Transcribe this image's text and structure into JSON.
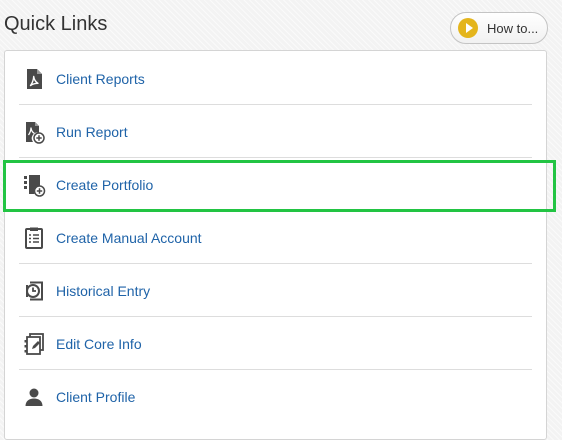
{
  "header": {
    "title": "Quick Links",
    "howto_label": "How to..."
  },
  "quick_links": [
    {
      "label": "Client Reports",
      "icon": "pdf-document-icon"
    },
    {
      "label": "Run Report",
      "icon": "run-report-icon"
    },
    {
      "label": "Create Portfolio",
      "icon": "create-portfolio-icon"
    },
    {
      "label": "Create Manual Account",
      "icon": "manual-account-icon"
    },
    {
      "label": "Historical Entry",
      "icon": "history-clock-icon"
    },
    {
      "label": "Edit Core Info",
      "icon": "edit-core-info-icon"
    },
    {
      "label": "Client Profile",
      "icon": "user-profile-icon"
    }
  ],
  "highlighted_item": "Create Portfolio",
  "colors": {
    "link": "#1f63a8",
    "highlight": "#22c443",
    "play_button": "#e4b51c",
    "icon": "#4a4a4a"
  }
}
